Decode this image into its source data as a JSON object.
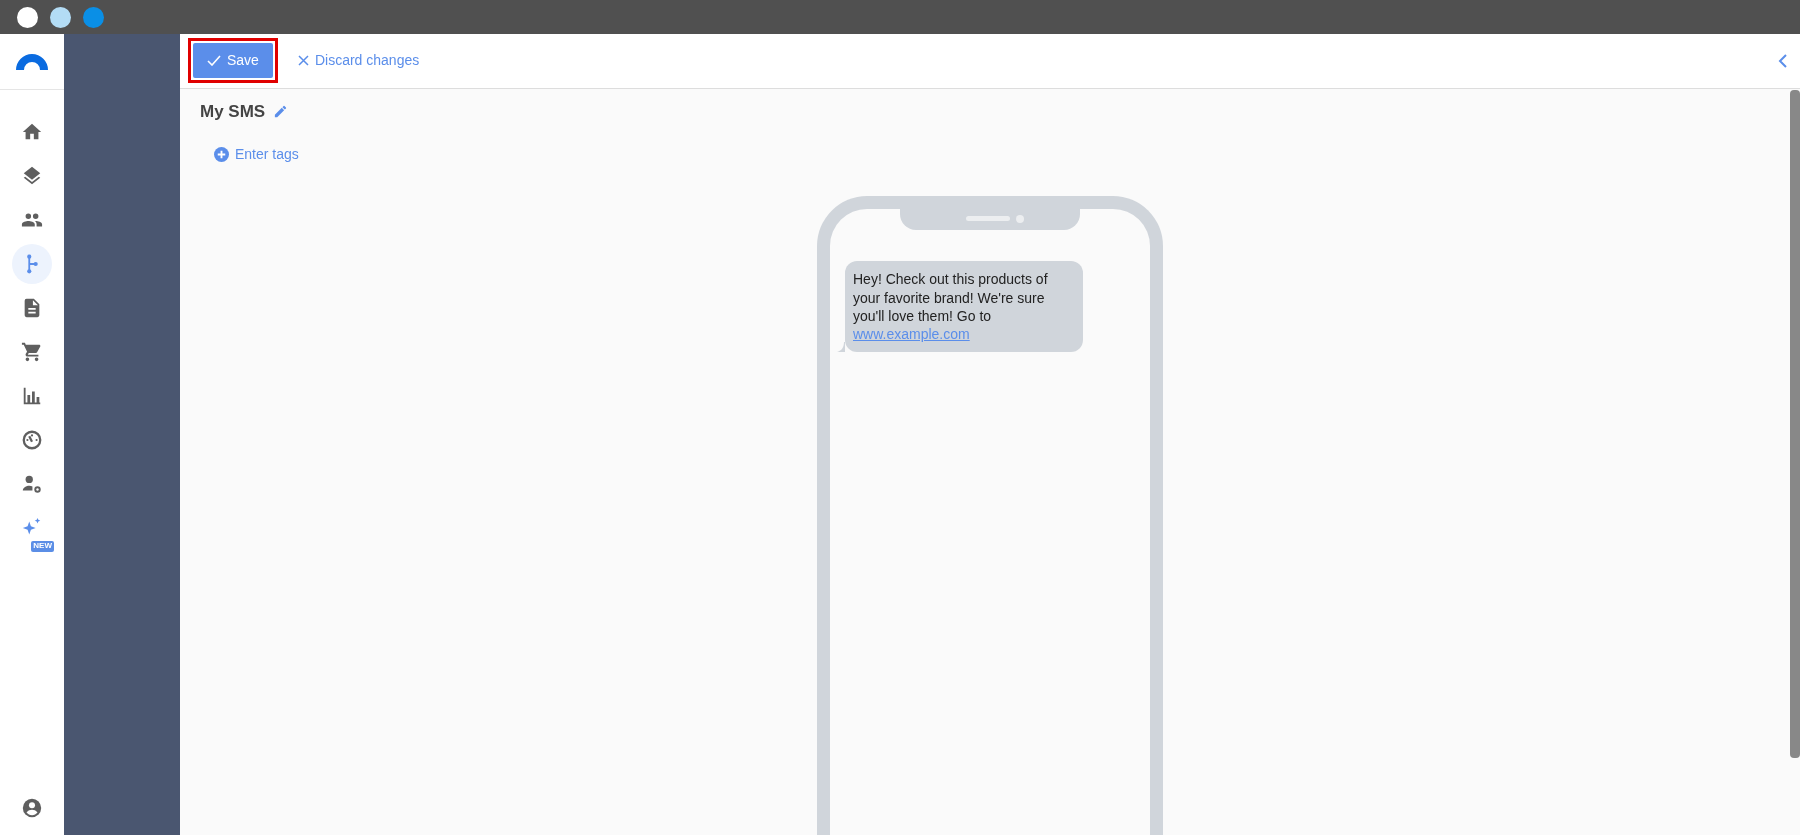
{
  "window_controls": [
    {
      "color": "#ffffff"
    },
    {
      "color": "#b3dcf5"
    },
    {
      "color": "#0a8fe6"
    }
  ],
  "sidebar": {
    "items": [
      {
        "kind": "home",
        "selected": false
      },
      {
        "kind": "layers",
        "selected": false
      },
      {
        "kind": "people",
        "selected": false
      },
      {
        "kind": "branch",
        "selected": true
      },
      {
        "kind": "document",
        "selected": false
      },
      {
        "kind": "cart",
        "selected": false
      },
      {
        "kind": "chart",
        "selected": false
      },
      {
        "kind": "gauge",
        "selected": false
      },
      {
        "kind": "user-settings",
        "selected": false
      },
      {
        "kind": "sparkle",
        "selected": false,
        "badge": "NEW"
      }
    ]
  },
  "toolbar": {
    "save": {
      "label": "Save",
      "highlighted": true
    },
    "discard": {
      "label": "Discard changes"
    }
  },
  "editor": {
    "title": "My SMS",
    "tags_link": "Enter tags"
  },
  "message": {
    "text": "Hey! Check out this products of your favorite brand! We're sure you'll love them! Go to ",
    "link": "www.example.com"
  }
}
